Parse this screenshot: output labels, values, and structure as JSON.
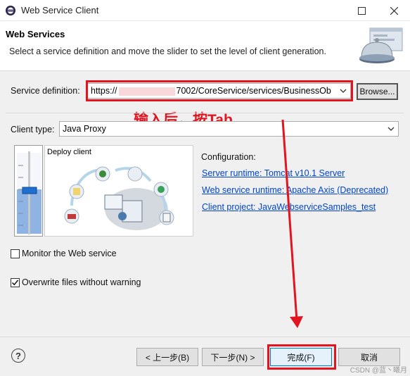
{
  "window": {
    "title": "Web Service Client"
  },
  "header": {
    "title": "Web Services",
    "description": "Select a service definition and move the slider to set the level of client generation."
  },
  "service": {
    "label": "Service definition:",
    "url_prefix": "https://",
    "url_suffix": "7002/CoreService/services/BusinessOb",
    "browse_label": "Browse..."
  },
  "annotation": "输入后，按Tab",
  "client_type": {
    "label": "Client type:",
    "value": "Java Proxy"
  },
  "slider": {
    "level_label": "Deploy client"
  },
  "configuration": {
    "heading": "Configuration:",
    "server_runtime": "Server runtime: Tomcat v10.1 Server",
    "ws_runtime": "Web service runtime: Apache Axis (Deprecated)",
    "client_project": "Client project: JavaWebserviceSamples_test"
  },
  "options": {
    "monitor_label": "Monitor the Web service",
    "monitor_checked": false,
    "overwrite_label": "Overwrite files without warning",
    "overwrite_checked": true
  },
  "footer": {
    "back_label": "< 上一步(B)",
    "next_label": "下一步(N) >",
    "finish_label": "完成(F)",
    "cancel_label": "取消"
  },
  "watermark": "CSDN @蓝丶曦月",
  "colors": {
    "annotation_red": "#e2141f",
    "link_blue": "#0044cc",
    "slider_blue": "#1f6fd1"
  }
}
